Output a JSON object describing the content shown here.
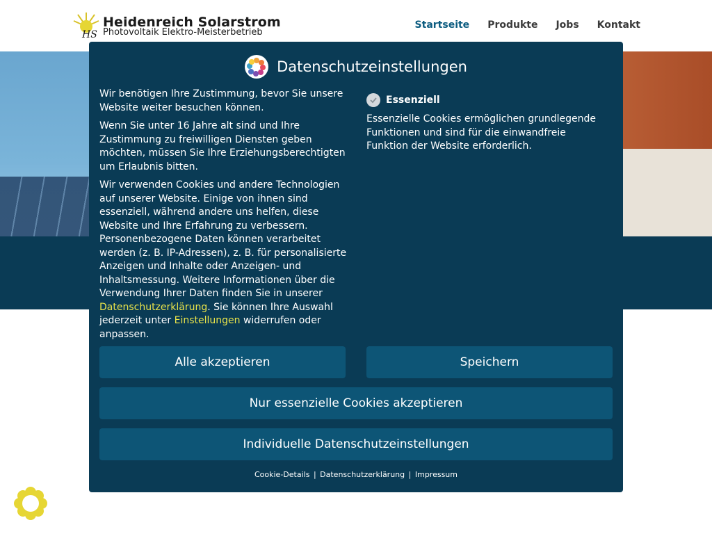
{
  "header": {
    "brand_title": "Heidenreich Solarstrom",
    "brand_subtitle": "Photovoltaik Elektro-Meisterbetrieb",
    "nav": [
      {
        "label": "Startseite",
        "active": true
      },
      {
        "label": "Produkte",
        "active": false
      },
      {
        "label": "Jobs",
        "active": false
      },
      {
        "label": "Kontakt",
        "active": false
      }
    ]
  },
  "page": {
    "banner_text": "",
    "heading": "",
    "paragraphs": []
  },
  "modal": {
    "title": "Datenschutzeinstellungen",
    "intro_p1": "Wir benötigen Ihre Zustimmung, bevor Sie unsere Website weiter besuchen können.",
    "intro_p2": "Wenn Sie unter 16 Jahre alt sind und Ihre Zustimmung zu freiwilligen Diensten geben möchten, müssen Sie Ihre Erziehungsberechtigten um Erlaubnis bitten.",
    "intro_p3_a": "Wir verwenden Cookies und andere Technologien auf unserer Website. Einige von ihnen sind essenziell, während andere uns helfen, diese Website und Ihre Erfahrung zu verbessern. Personenbezogene Daten können verarbeitet werden (z. B. IP-Adressen), z. B. für personalisierte Anzeigen und Inhalte oder Anzeigen- und Inhaltsmessung. Weitere Informationen über die Verwendung Ihrer Daten finden Sie in unserer ",
    "intro_p3_link1": "Datenschutzerklärung",
    "intro_p3_b": ". Sie können Ihre Auswahl jederzeit unter ",
    "intro_p3_link2": "Einstellungen",
    "intro_p3_c": " widerrufen oder anpassen.",
    "essential_label": "Essenziell",
    "essential_checked": true,
    "essential_desc": "Essenzielle Cookies ermöglichen grundlegende Funktionen und sind für die einwandfreie Funktion der Website erforderlich.",
    "buttons": {
      "accept_all": "Alle akzeptieren",
      "save": "Speichern",
      "essential_only": "Nur essenzielle Cookies akzeptieren",
      "individual": "Individuelle Datenschutzeinstellungen"
    },
    "footer_links": {
      "cookie_details": "Cookie-Details",
      "privacy": "Datenschutzerklärung",
      "imprint": "Impressum"
    },
    "footer_separator": "|"
  },
  "colors": {
    "modal_bg": "#0a3b55",
    "button_bg": "#0d5576",
    "link_yellow": "#e9e34a",
    "nav_active": "#0c5c80"
  },
  "icons": {
    "brand": "sun-logo-icon",
    "modal": "privacy-flower-icon",
    "check": "check-icon",
    "badge": "privacy-badge-icon"
  }
}
